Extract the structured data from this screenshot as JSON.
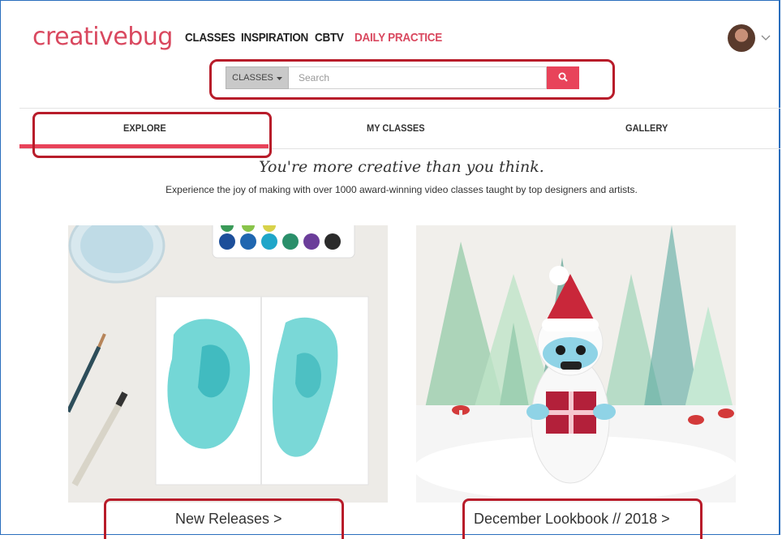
{
  "brand": {
    "logo_text": "creativebug",
    "accent_color": "#d9485f"
  },
  "nav": {
    "items": [
      {
        "label": "CLASSES"
      },
      {
        "label": "INSPIRATION"
      },
      {
        "label": "CBTV"
      },
      {
        "label": "DAILY PRACTICE",
        "active": true
      }
    ]
  },
  "account": {
    "avatar_icon": "user-avatar",
    "menu_icon": "chevron-down-icon"
  },
  "search": {
    "category_label": "CLASSES",
    "category_icon": "caret-down-icon",
    "placeholder": "Search",
    "value": "",
    "button_icon": "search-icon",
    "button_color": "#e8435a"
  },
  "tabs": [
    {
      "label": "EXPLORE",
      "active": true
    },
    {
      "label": "MY CLASSES"
    },
    {
      "label": "GALLERY"
    }
  ],
  "hero": {
    "tagline": "You're more creative than you think.",
    "subtitle": "Experience the joy of making with over 1000 award-winning video classes taught by top designers and artists."
  },
  "cards": [
    {
      "label": "New Releases >",
      "image": "watercolor-painting-photo"
    },
    {
      "label": "December Lookbook // 2018 >",
      "image": "crochet-yeti-photo"
    }
  ],
  "highlight_color": "#b81c2a"
}
